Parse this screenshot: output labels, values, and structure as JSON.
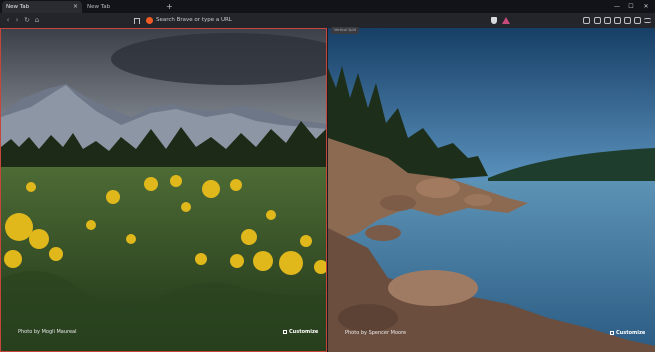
{
  "tabs": [
    {
      "label": "New Tab",
      "active": true
    },
    {
      "label": "New Tab",
      "active": false
    }
  ],
  "tab_close_glyph": "×",
  "new_tab_glyph": "+",
  "window_controls": {
    "minimize": "—",
    "maximize": "☐",
    "close": "✕"
  },
  "nav": {
    "back": "‹",
    "forward": "›",
    "reload": "↻",
    "home": "⌂"
  },
  "address_bar": {
    "placeholder": "Search Brave or type a URL"
  },
  "split_tooltip": "Vertical Split",
  "left_pane": {
    "photo_credit": "Photo by Mogli Maureal",
    "customize_label": "Customize"
  },
  "right_pane": {
    "photo_credit": "Photo by Spencer Moore",
    "customize_label": "Customize"
  },
  "colors": {
    "accent_border": "#c6463c",
    "brave_orange": "#f05a24"
  }
}
